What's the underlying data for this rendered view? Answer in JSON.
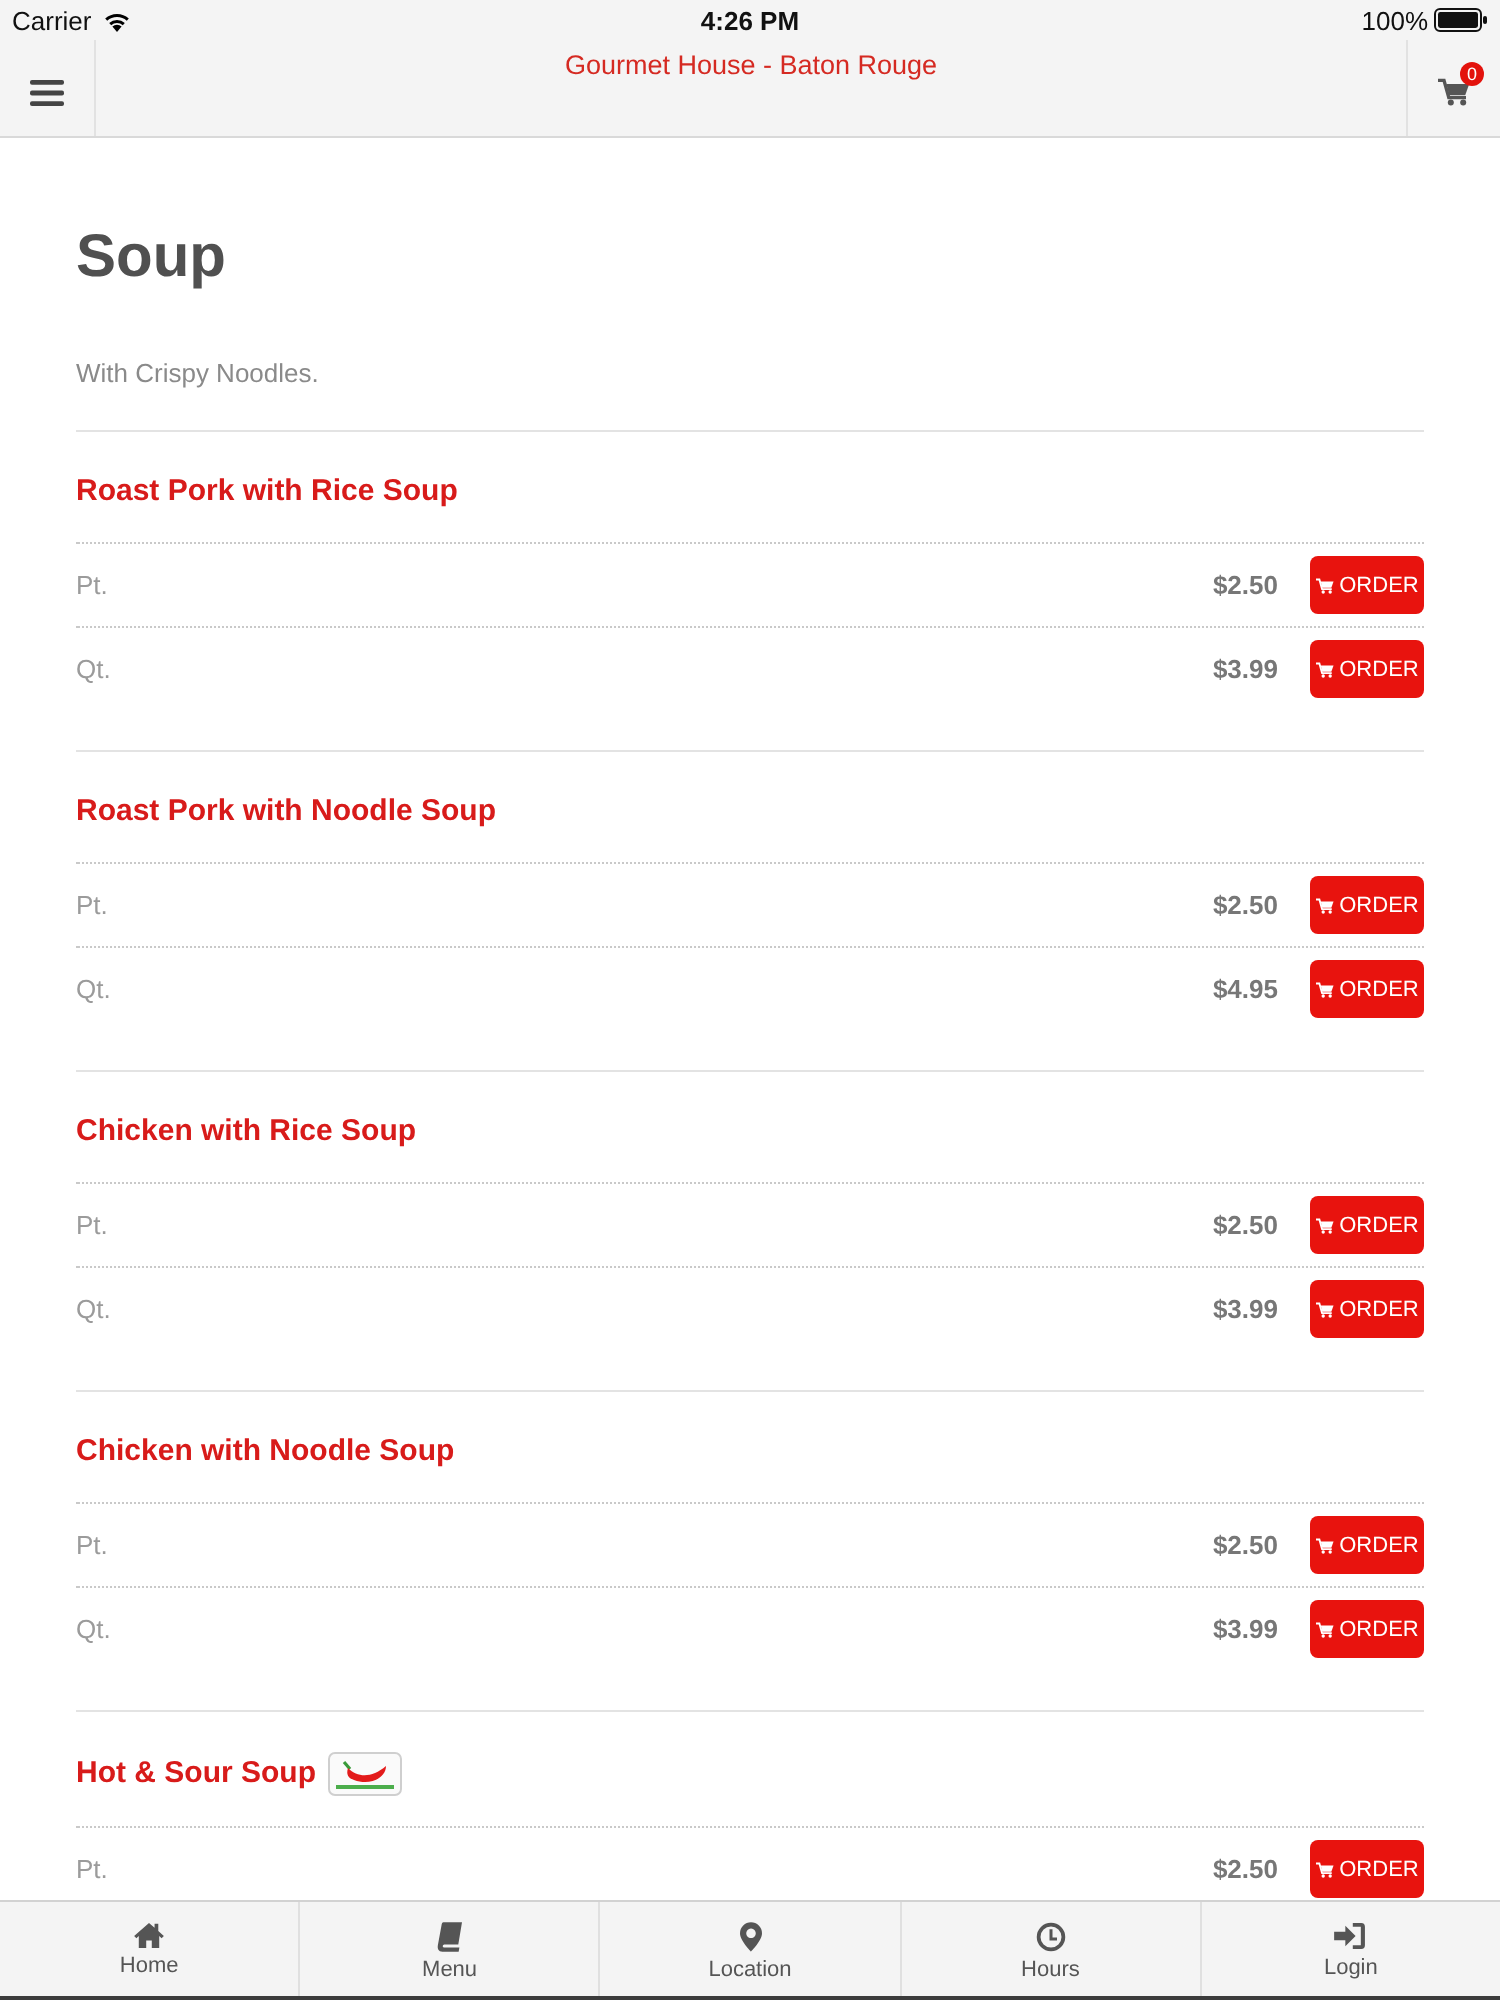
{
  "status_bar": {
    "carrier": "Carrier",
    "time": "4:26 PM",
    "battery": "100%"
  },
  "header": {
    "title": "Gourmet House - Baton Rouge",
    "cart_count": "0"
  },
  "category": {
    "title": "Soup",
    "description": "With Crispy Noodles."
  },
  "items": [
    {
      "name": "Roast Pork with Rice Soup",
      "spicy": false,
      "options": [
        {
          "size": "Pt.",
          "price": "$2.50",
          "order_label": "ORDER"
        },
        {
          "size": "Qt.",
          "price": "$3.99",
          "order_label": "ORDER"
        }
      ]
    },
    {
      "name": "Roast Pork with Noodle Soup",
      "spicy": false,
      "options": [
        {
          "size": "Pt.",
          "price": "$2.50",
          "order_label": "ORDER"
        },
        {
          "size": "Qt.",
          "price": "$4.95",
          "order_label": "ORDER"
        }
      ]
    },
    {
      "name": "Chicken with Rice Soup",
      "spicy": false,
      "options": [
        {
          "size": "Pt.",
          "price": "$2.50",
          "order_label": "ORDER"
        },
        {
          "size": "Qt.",
          "price": "$3.99",
          "order_label": "ORDER"
        }
      ]
    },
    {
      "name": "Chicken with Noodle Soup",
      "spicy": false,
      "options": [
        {
          "size": "Pt.",
          "price": "$2.50",
          "order_label": "ORDER"
        },
        {
          "size": "Qt.",
          "price": "$3.99",
          "order_label": "ORDER"
        }
      ]
    },
    {
      "name": "Hot & Sour Soup",
      "spicy": true,
      "options": [
        {
          "size": "Pt.",
          "price": "$2.50",
          "order_label": "ORDER"
        }
      ]
    }
  ],
  "tab_bar": [
    {
      "label": "Home"
    },
    {
      "label": "Menu"
    },
    {
      "label": "Location"
    },
    {
      "label": "Hours"
    },
    {
      "label": "Login"
    }
  ]
}
